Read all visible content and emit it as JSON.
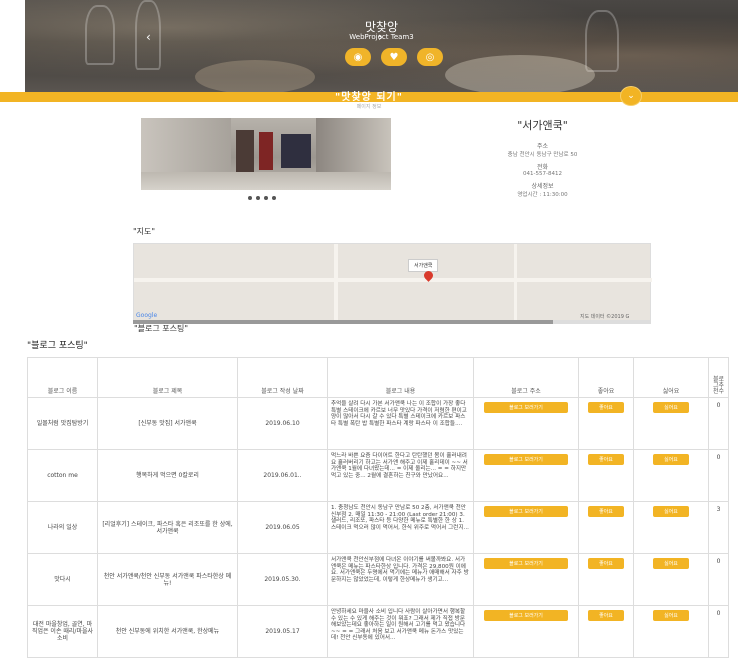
{
  "header": {
    "title": "맛찾앙",
    "subtitle": "WebProject Team3",
    "icons": [
      "eye-icon",
      "heart-icon",
      "target-icon"
    ]
  },
  "bar": {
    "title": "\"맛찾앙 되기\"",
    "subtitle": "페이지 정보",
    "toggle": "⌄"
  },
  "shop": {
    "name": "\"서가앤쿡\"",
    "address_label": "주소",
    "address": "충남 천안시 동남구 만남로 50",
    "phone_label": "전화",
    "phone": "041-557-8412",
    "detail_label": "상세정보",
    "hours": "영업시간 : 11:30:00",
    "carousel_dots": 4
  },
  "map": {
    "section_title": "\"지도\"",
    "marker_label": "서가앤쿡",
    "provider": "Google",
    "credit": "지도 데이터 ©2019 G"
  },
  "blog": {
    "section_title_partial": "\"블로그 포스팅\"",
    "section_title": "\"블로그 포스팅\"",
    "columns": [
      "블로그 이름",
      "블로그 제목",
      "블로그 작성 날짜",
      "블로그 내용",
      "블로그 주소",
      "좋아요",
      "싫어요",
      "블로그추천수"
    ],
    "button_labels": {
      "visit": "블로그 보러가기",
      "like": "좋아요",
      "dislike": "싫어요"
    },
    "rows": [
      {
        "name": "일몰처럼 맛집탐방기",
        "title": "[신부동 맛집] 서가앤쿡",
        "date": "2019.06.10",
        "content": "추억을 살려 다시 가본 서가앤쿡 나는 이 조합이 가장 좋다 특별 스테이크에 카르보 너무 맛있다 가격이 저렴한 편이고 양이 많아서 다시 갈 수 있다 특별 스테이크에 카르보 파스타 특별 폭탄 밥 특별한 파스타 계랑 파스타 이 조합들....",
        "recommend": "0"
      },
      {
        "name": "cotton me",
        "title": "행복하게 먹으면 0칼로리",
        "date": "2019.06.01..",
        "content": "먹느라 바쁜 요즘 다이어트 한다고 탄탄했던 몸이 흘러내려요 흘러버리기 하고는 서가앤 해주고 이제 홀리데이 ~~ 서가앤쿡 1월에 다녀왔는데... = 이제 올리는... = = 하지만 먹고 있는 중... 2월에 결혼하는 친구와 만났어요...",
        "recommend": "0"
      },
      {
        "name": "나라의 일상",
        "title": "[리얼후기] 스테이크, 파스타 혹은 리조또를 한 상에, 서가앤쿡",
        "date": "2019.06.05",
        "content": "1. 충청남도 천안시 동남구 만남로 50 2층, 서가앤쿡 천안신부점 2. 매일 11:30 - 21:00 (Last order 21:00) 3. 샐러드, 리조또, 파스타 등 다양한 메뉴로 특별한 한 상 1. 스테이크 먹으러 많이 먹어서, 한식 위주로 먹어서 그런지...",
        "recommend": "3"
      },
      {
        "name": "맛다시",
        "title": "천안 서가앤쿡/천안 신부동 서가앤쿡 파스타한상 메뉴!",
        "date": "2019.05.30.",
        "content": "서가앤쿡 천안신부점에 다녀온 이야기를 써볼까봐요. 서가앤쿡은 메뉴는 파스타한상 입니다. 가격은 29,800원 이에요. 서가앤쿡은 두명에서 먹기에는 메뉴가 애매해서 자주 방문하지는 않았었는데, 이렇게 한상메뉴가 생기고...",
        "recommend": "0"
      },
      {
        "name": "대전 마을창업, 골연, 마직업은 이손 때리/마을사 소비",
        "title": "천안 신부동에 위치한 서가앤쿡, 한상메뉴",
        "date": "2019.05.17",
        "content": "안녕하세요 마을사 소비 입니다 사람이 살아가면서 행복할 수 있는 수 있게 해주는 것이 뭐죠? 그래서 제가 직접 방문해보았는데요 좋아하는 일이 원해서 고기를 먹고 왔습니다~~ = = 그래서 처음 보고 서가앤쿡 메뉴 돈가스 맛있는데! 천안 신부동에 있어서...",
        "recommend": "0"
      }
    ]
  }
}
